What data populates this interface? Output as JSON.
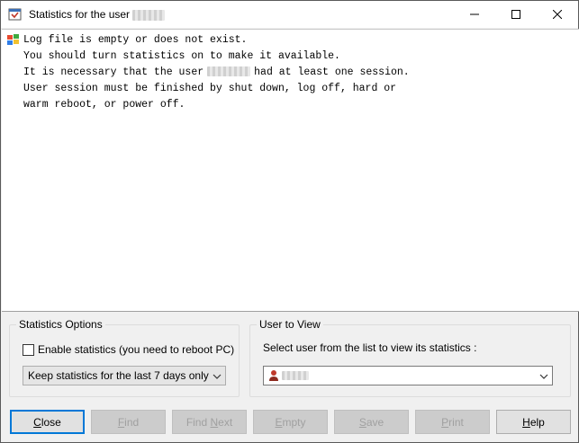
{
  "window": {
    "title": "Statistics for the user",
    "minimize_icon": "minimize-icon",
    "maximize_icon": "maximize-icon",
    "close_icon": "close-icon"
  },
  "log": {
    "icon": "windows-log-icon",
    "lines": {
      "l1": "Log file is empty or does not exist.",
      "l2": "You should turn statistics on to make it available.",
      "l3a": "It is necessary that the user",
      "l3b": "had at least one session.",
      "l4": "User session must be finished by shut down, log off, hard or",
      "l5": "warm reboot, or power off."
    }
  },
  "stats_options": {
    "legend": "Statistics Options",
    "enable_label": "Enable statistics (you need to reboot PC)",
    "enable_checked": false,
    "keep_value": "Keep statistics for the last 7 days only"
  },
  "user_to_view": {
    "legend": "User to View",
    "prompt": "Select user from the list to view its statistics :",
    "user_icon": "user-icon"
  },
  "buttons": {
    "close": {
      "prefix": "",
      "u": "C",
      "rest": "lose"
    },
    "find": {
      "prefix": "",
      "u": "F",
      "rest": "ind"
    },
    "find_next": {
      "prefix": "Find ",
      "u": "N",
      "rest": "ext"
    },
    "empty": {
      "prefix": "",
      "u": "E",
      "rest": "mpty"
    },
    "save": {
      "prefix": "",
      "u": "S",
      "rest": "ave"
    },
    "print": {
      "prefix": "",
      "u": "P",
      "rest": "rint"
    },
    "help": {
      "prefix": "",
      "u": "H",
      "rest": "elp"
    }
  }
}
